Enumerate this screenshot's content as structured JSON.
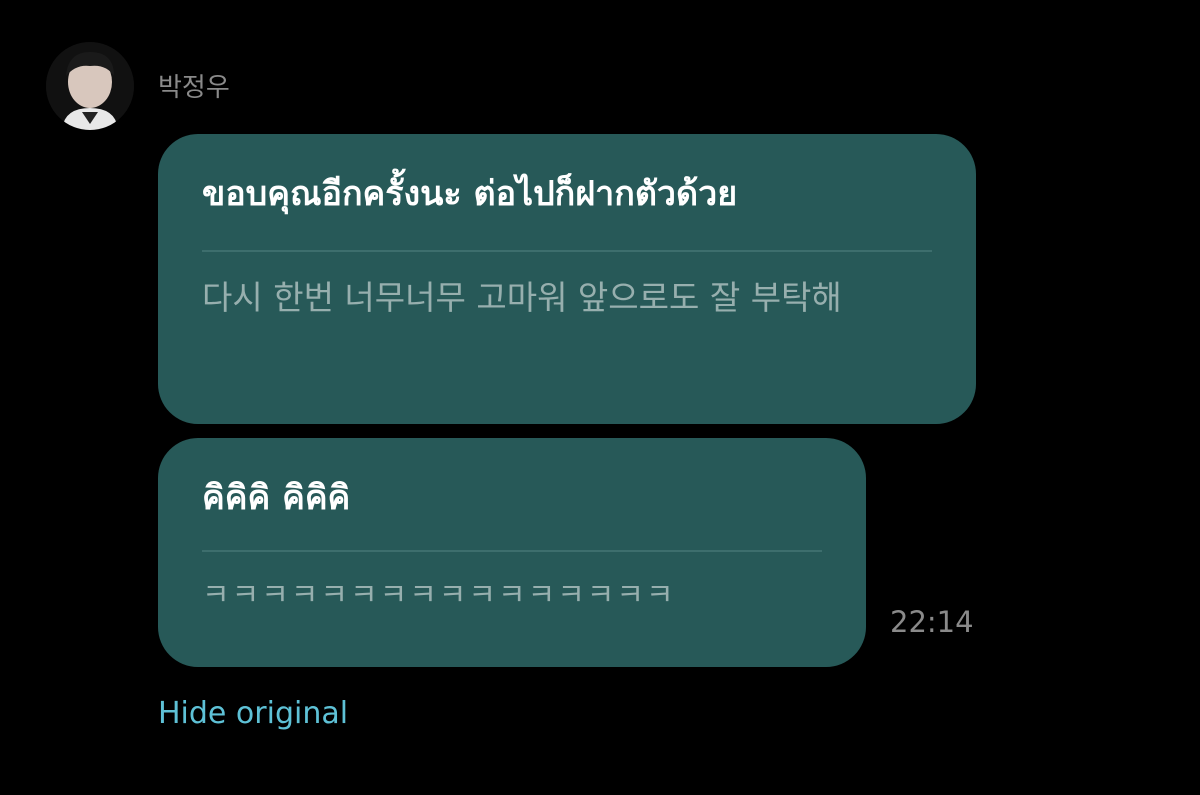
{
  "conversation": {
    "sender_name": "박정우",
    "avatar_icon": "profile-photo",
    "messages": [
      {
        "translated": "ขอบคุณอีกครั้งนะ ต่อไปก็ฝากตัวด้วย",
        "original": "다시 한번 너무너무 고마워 앞으로도 잘 부탁해"
      },
      {
        "translated": "คิคิคิ คิคิคิ",
        "original": "ㅋㅋㅋㅋㅋㅋㅋㅋㅋㅋㅋㅋㅋㅋㅋㅋ"
      }
    ],
    "timestamp": "22:14",
    "hide_original_label": "Hide original"
  },
  "colors": {
    "background": "#000000",
    "bubble": "#275958",
    "translated_text": "#ffffff",
    "original_text": "#97afae",
    "link": "#5ec1d6",
    "meta_text": "#8a8a8a"
  }
}
